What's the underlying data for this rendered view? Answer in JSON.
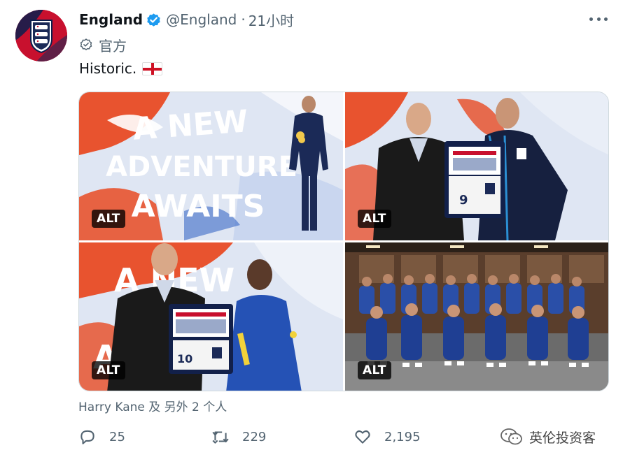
{
  "author": {
    "name": "England",
    "handle": "@England",
    "separator": "·",
    "time": "21小时",
    "label": "官方",
    "avatar_icon": "three-lions-crest-icon",
    "verified_icon": "verified-badge-icon"
  },
  "tweet": {
    "text": "Historic."
  },
  "media": {
    "images": [
      {
        "alt_label": "ALT",
        "banner_lines": [
          "A NEW",
          "ADVENTURE",
          "AWAITS"
        ]
      },
      {
        "alt_label": "ALT",
        "shirt_number": "9"
      },
      {
        "alt_label": "ALT",
        "banner_lines": [
          "A NEW",
          "A"
        ],
        "shirt_number": "10"
      },
      {
        "alt_label": "ALT"
      }
    ]
  },
  "tagged": "Harry Kane 及 另外 2 个人",
  "actions": {
    "reply_count": "25",
    "retweet_count": "229",
    "like_count": "2,195",
    "watermark": "英伦投资客"
  },
  "colors": {
    "accent_blue": "#1d9bf0",
    "muted": "#536471",
    "england_red": "#ce1124",
    "navy": "#1b2a57"
  }
}
